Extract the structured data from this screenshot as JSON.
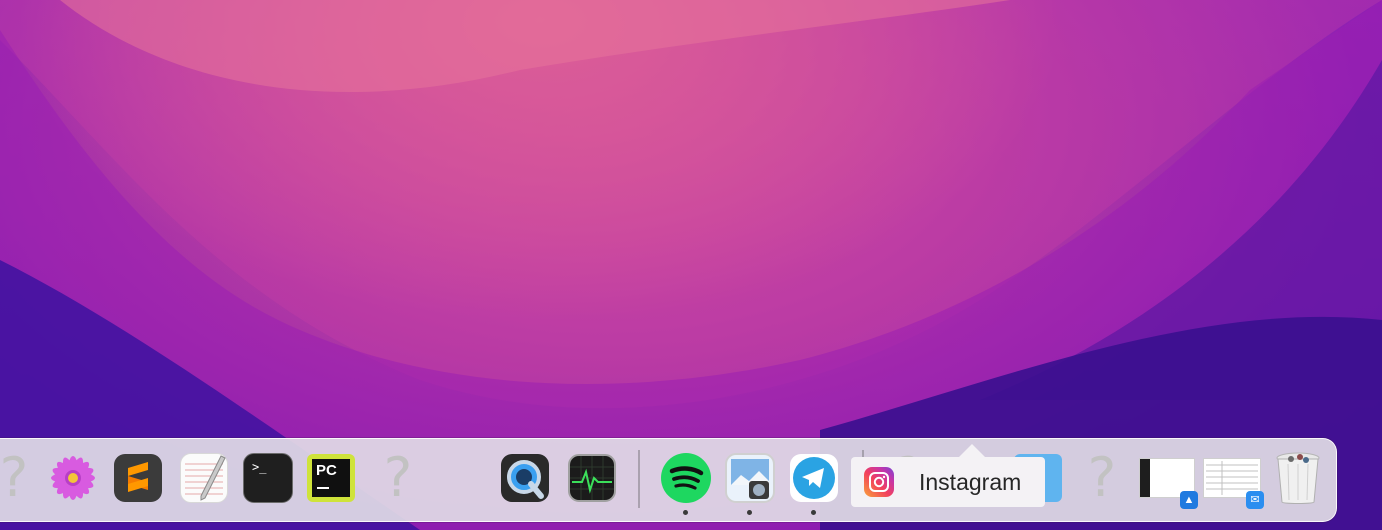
{
  "desktop": {
    "wallpaper": "macOS Monterey",
    "colors": {
      "accent_pink": "#e7708f",
      "magenta": "#b231a9",
      "purple": "#6a12ae"
    }
  },
  "dock": {
    "apps": [
      {
        "name": "Unknown app",
        "icon": "question-mark-icon",
        "running": false
      },
      {
        "name": "Daisy Disk",
        "icon": "flower-icon",
        "running": false
      },
      {
        "name": "Sublime Text",
        "icon": "sublime-icon",
        "running": false
      },
      {
        "name": "TextEdit",
        "icon": "textedit-icon",
        "running": false
      },
      {
        "name": "Terminal",
        "icon": "terminal-icon",
        "running": false,
        "glyph": ">_"
      },
      {
        "name": "PyCharm",
        "icon": "pycharm-icon",
        "running": false,
        "glyph": "PC"
      },
      {
        "name": "Unknown app",
        "icon": "question-mark-icon",
        "running": false
      },
      {
        "name": "QuickTime Player",
        "icon": "quicktime-icon",
        "running": false
      },
      {
        "name": "Activity Monitor",
        "icon": "activity-monitor-icon",
        "running": false
      },
      {
        "name": "Spotify",
        "icon": "spotify-icon",
        "running": true
      },
      {
        "name": "Preview",
        "icon": "preview-icon",
        "running": true
      },
      {
        "name": "Telegram",
        "icon": "telegram-icon",
        "running": true
      },
      {
        "name": "Instagram",
        "icon": "instagram-icon",
        "running": false
      },
      {
        "name": "Unknown app",
        "icon": "question-mark-icon",
        "running": false
      },
      {
        "name": "Folder",
        "icon": "folder-icon",
        "running": false
      },
      {
        "name": "Unknown app",
        "icon": "question-mark-icon",
        "running": false
      },
      {
        "name": "Window minimized",
        "icon": "window-thumbnail-icon",
        "running": false
      },
      {
        "name": "Window minimized",
        "icon": "window-thumbnail-icon",
        "running": false
      },
      {
        "name": "Trash",
        "icon": "trash-icon",
        "running": false
      }
    ],
    "question_glyph": "?",
    "tooltip": {
      "label": "Instagram"
    }
  }
}
